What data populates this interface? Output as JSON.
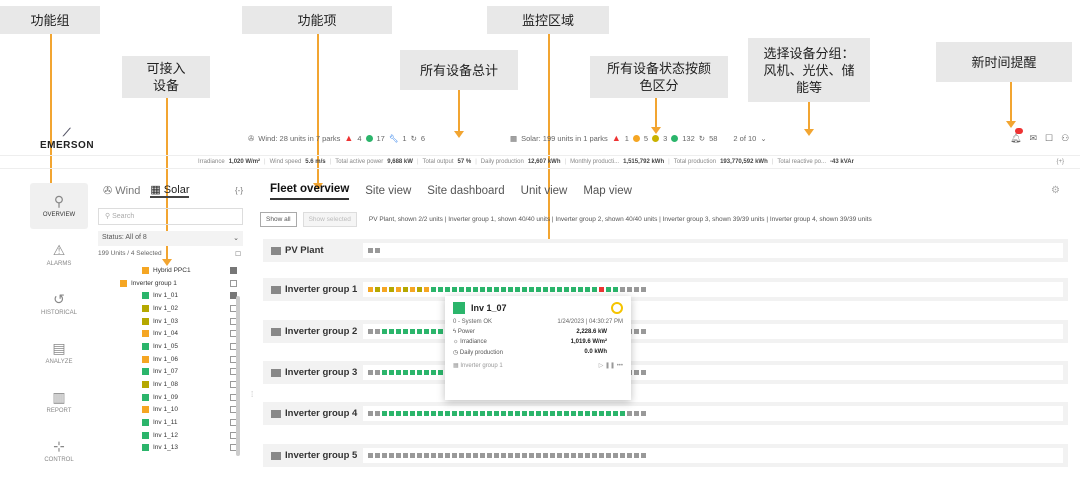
{
  "annotations": {
    "function_group": "功能组",
    "function_items": "功能项",
    "monitoring_area": "监控区域",
    "accessible_devices": "可接入设备",
    "all_devices_total": "所有设备总计",
    "status_by_color": "所有设备状态按颜色区分",
    "select_device_group": "选择设备分组：风机、光伏、储能等",
    "new_time_reminder": "新时间提醒"
  },
  "header": {
    "logo": "EMERSON",
    "wind": "Wind: 28 units in 7 parks",
    "wind_alarm": "4",
    "wind_ok": "17",
    "wind_maint": "1",
    "wind_other": "6",
    "solar": "Solar: 199 units in 1 parks",
    "solar_alarm": "1",
    "solar_orange": "5",
    "solar_yellow": "3",
    "solar_ok": "132",
    "solar_other": "58",
    "pager": "2 of 10"
  },
  "infobar": {
    "irradiance_label": "Irradiance",
    "irradiance": "1,020 W/m²",
    "wind_speed_label": "Wind speed",
    "wind_speed": "5.6 m/s",
    "active_power_label": "Total active power",
    "active_power": "9,688 kW",
    "output_label": "Total output",
    "output": "57 %",
    "daily_label": "Daily production",
    "daily": "12,607 kWh",
    "monthly_label": "Monthly producti...",
    "monthly": "1,515,792 kWh",
    "total_label": "Total production",
    "total": "193,770,592 kWh",
    "reactive_label": "Total reactive po...",
    "reactive": "-43 kVAr"
  },
  "rail": [
    "OVERVIEW",
    "ALARMS",
    "HISTORICAL",
    "ANALYZE",
    "REPORT",
    "CONTROL"
  ],
  "devices": {
    "tab_wind": "Wind",
    "tab_solar": "Solar",
    "search_placeholder": "Search",
    "status": "Status:  All of 8",
    "count": "199 Units / 4 Selected",
    "items": [
      {
        "label": "Hybrid PPC1",
        "color": "#f5a623",
        "checked": true
      },
      {
        "label": "Inverter group 1",
        "color": "#f5a623",
        "checked": false
      },
      {
        "label": "Inv 1_01",
        "color": "#2bb56b",
        "checked": true
      },
      {
        "label": "Inv 1_02",
        "color": "#b5a800",
        "checked": false
      },
      {
        "label": "Inv 1_03",
        "color": "#b5a800",
        "checked": false
      },
      {
        "label": "Inv 1_04",
        "color": "#f5a623",
        "checked": false
      },
      {
        "label": "Inv 1_05",
        "color": "#2bb56b",
        "checked": false
      },
      {
        "label": "Inv 1_06",
        "color": "#f5a623",
        "checked": false
      },
      {
        "label": "Inv 1_07",
        "color": "#2bb56b",
        "checked": false
      },
      {
        "label": "Inv 1_08",
        "color": "#b5a800",
        "checked": false
      },
      {
        "label": "Inv 1_09",
        "color": "#2bb56b",
        "checked": false
      },
      {
        "label": "Inv 1_10",
        "color": "#f5a623",
        "checked": false
      },
      {
        "label": "Inv 1_11",
        "color": "#2bb56b",
        "checked": false
      },
      {
        "label": "Inv 1_12",
        "color": "#2bb56b",
        "checked": false
      },
      {
        "label": "Inv 1_13",
        "color": "#2bb56b",
        "checked": false
      }
    ]
  },
  "main": {
    "tabs": [
      "Fleet overview",
      "Site view",
      "Site dashboard",
      "Unit view",
      "Map view"
    ],
    "show_all": "Show all",
    "show_selected": "Show selected",
    "filter_info": "PV Plant, shown 2/2 units  |  Inverter group 1, shown 40/40 units  |  Inverter group 2, shown 40/40 units  |  Inverter group 3, shown 39/39 units  |  Inverter group 4, shown 39/39 units",
    "groups": [
      "PV Plant",
      "Inverter group 1",
      "Inverter group 2",
      "Inverter group 3",
      "Inverter group 4",
      "Inverter group 5"
    ]
  },
  "popup": {
    "title": "Inv 1_07",
    "status": "0 - System OK",
    "time": "1/24/2023 | 04:30:27 PM",
    "power_label": "Power",
    "power": "2,228.6 kW",
    "irr_label": "Irradiance",
    "irr": "1,019.6 W/m²",
    "daily_label": "Daily production",
    "daily": "0.0 kWh",
    "group": "Inverter group 1"
  }
}
